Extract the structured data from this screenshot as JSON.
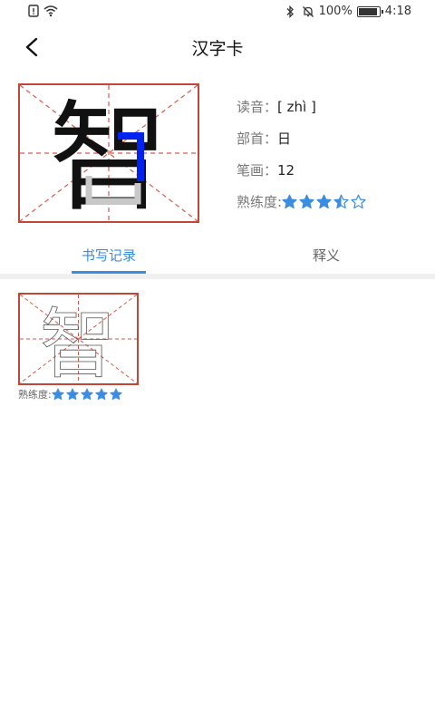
{
  "status_bar": {
    "battery": "100%",
    "battery_level": 1.0,
    "time": "4:18"
  },
  "header": {
    "title": "汉字卡",
    "back_icon": "chevron-left-icon"
  },
  "character": {
    "glyph": "智",
    "pinyin_label": "读音：",
    "pinyin_value": "[ zhì ]",
    "radical_label": "部首：",
    "radical_value": "日",
    "strokes_label": "笔画：",
    "strokes_value": "12",
    "proficiency_label": "熟练度:",
    "proficiency_stars": 3.5,
    "proficiency_max": 5
  },
  "tabs": [
    {
      "label": "书写记录",
      "active": true
    },
    {
      "label": "释义",
      "active": false
    }
  ],
  "records": [
    {
      "glyph": "智",
      "proficiency_label": "熟练度:",
      "stars": 5,
      "max": 5
    }
  ],
  "colors": {
    "accent": "#3a8de0",
    "grid_border": "#c0473a",
    "grid_dash": "#d65a4d",
    "stroke_highlight": "#0022ee",
    "star": "#3a8de0"
  }
}
